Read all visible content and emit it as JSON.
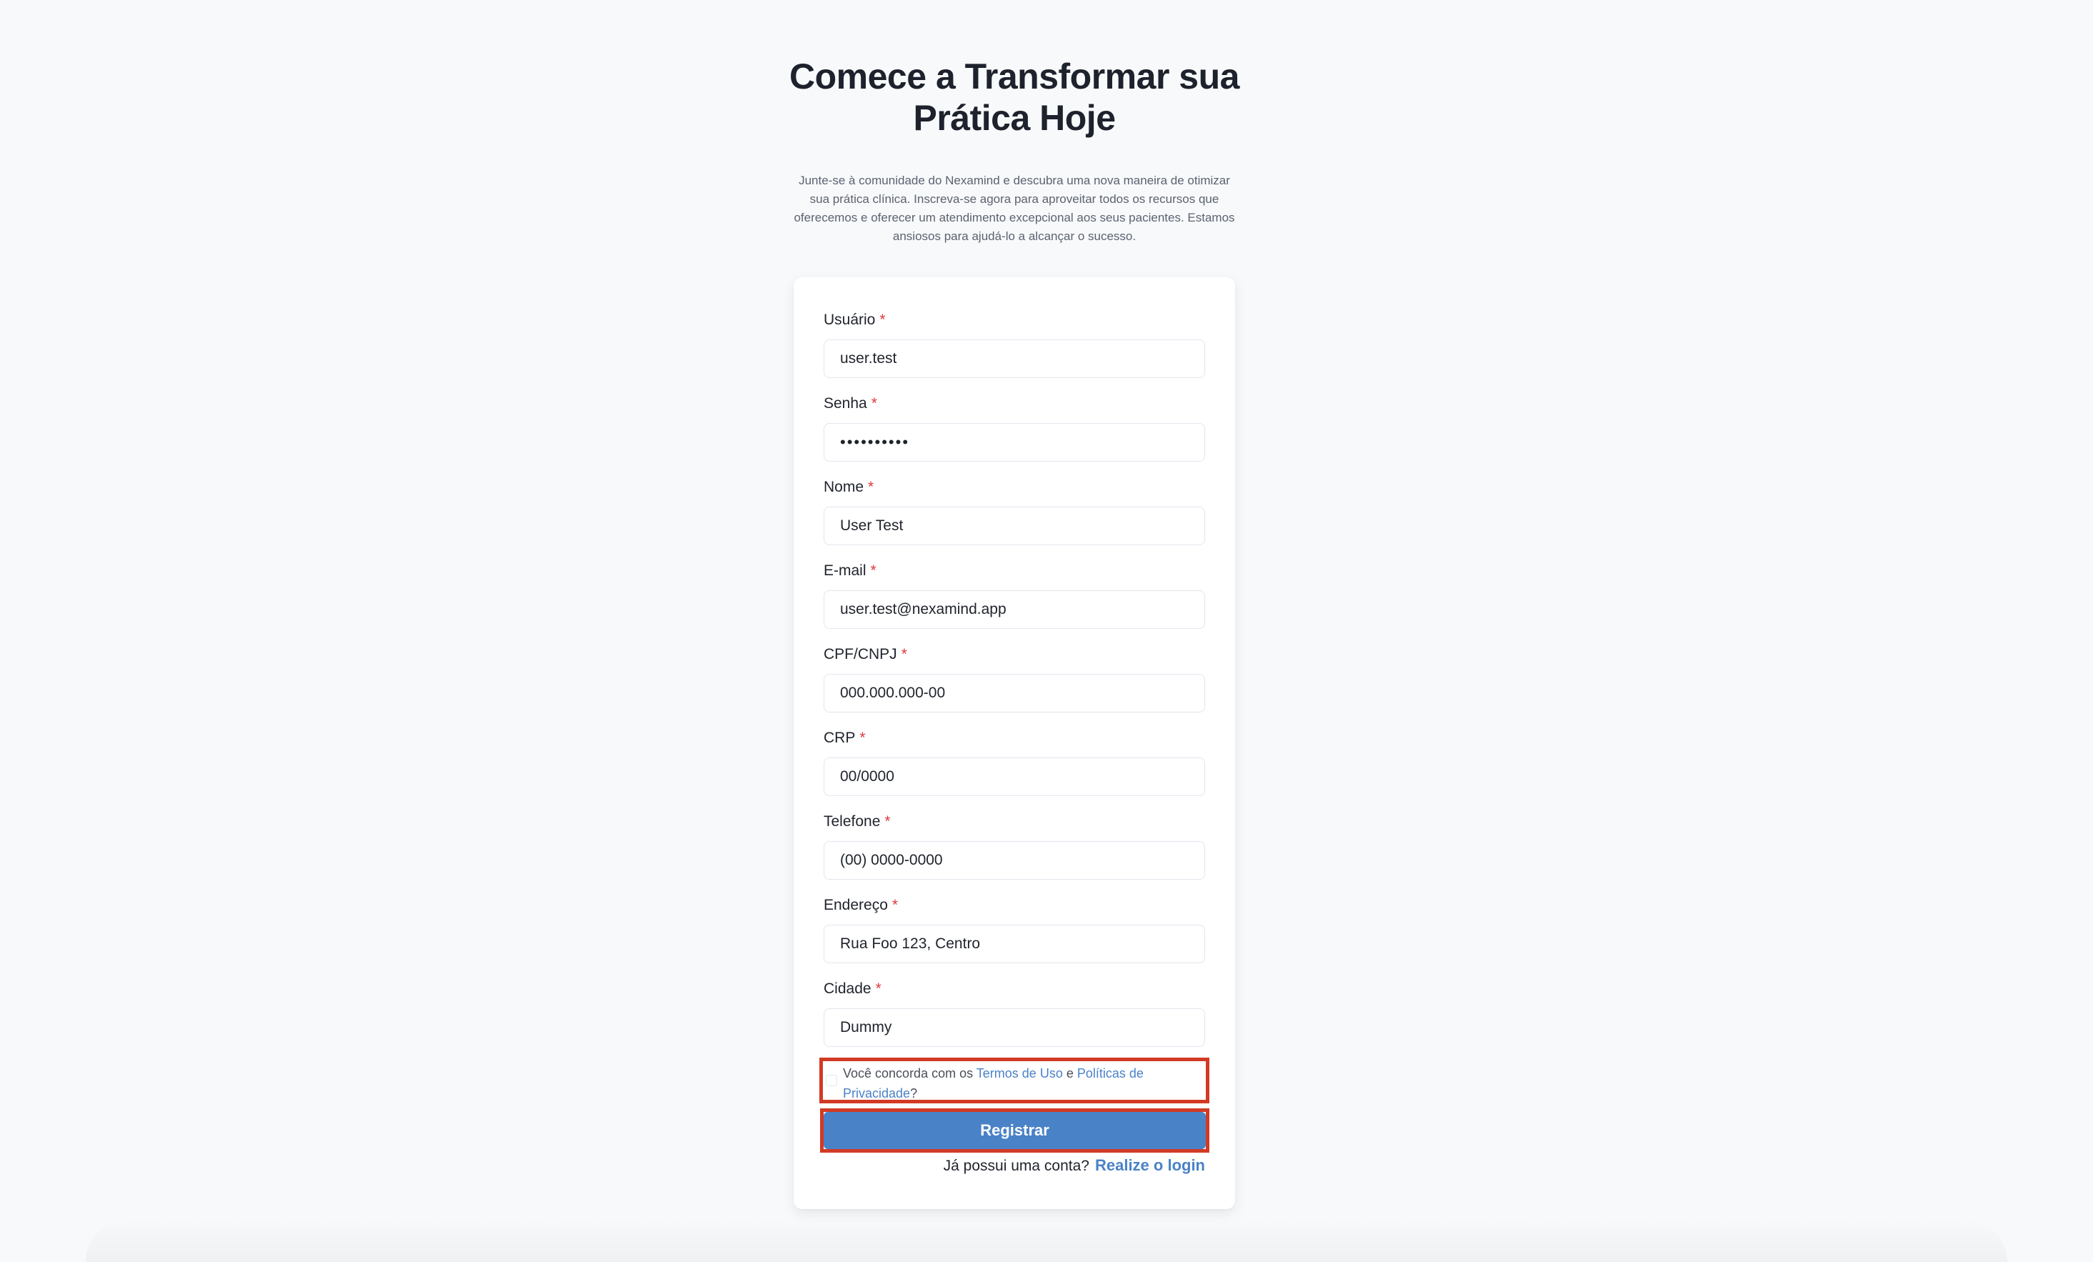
{
  "header": {
    "title": "Comece a Transformar sua Prática Hoje",
    "subtitle": "Junte-se à comunidade do Nexamind e descubra uma nova maneira de otimizar sua prática clínica. Inscreva-se agora para aproveitar todos os recursos que oferecemos e oferecer um atendimento excepcional aos seus pacientes. Estamos ansiosos para ajudá-lo a alcançar o sucesso."
  },
  "form": {
    "required_marker": "*",
    "fields": [
      {
        "label": "Usuário",
        "value": "user.test",
        "type": "text"
      },
      {
        "label": "Senha",
        "value": "••••••••••",
        "type": "password"
      },
      {
        "label": "Nome",
        "value": "User Test",
        "type": "text"
      },
      {
        "label": "E-mail",
        "value": "user.test@nexamind.app",
        "type": "email"
      },
      {
        "label": "CPF/CNPJ",
        "value": "000.000.000-00",
        "type": "text"
      },
      {
        "label": "CRP",
        "value": "00/0000",
        "type": "text"
      },
      {
        "label": "Telefone",
        "value": "(00) 0000-0000",
        "type": "tel"
      },
      {
        "label": "Endereço",
        "value": "Rua Foo 123, Centro",
        "type": "text"
      },
      {
        "label": "Cidade",
        "value": "Dummy",
        "type": "text"
      }
    ],
    "agreement": {
      "checked": false,
      "prefix": "Você concorda com os ",
      "terms_link": "Termos de Uso",
      "connector": " e ",
      "privacy_link": "Políticas de Privacidade",
      "suffix": "?"
    },
    "submit_label": "Registrar",
    "login_prompt": "Já possui uma conta?",
    "login_link": "Realize o login"
  },
  "colors": {
    "accent": "#4a82c8",
    "required": "#e03a3a",
    "highlight_outline": "#d23a24",
    "background": "#f8f9fb"
  }
}
